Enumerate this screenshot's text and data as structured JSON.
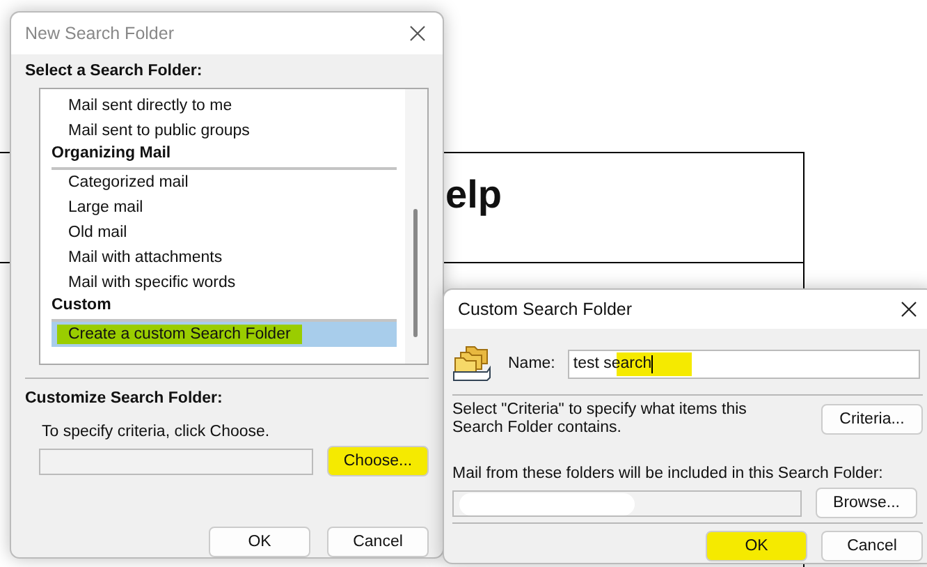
{
  "background_page": {
    "heading": "elp"
  },
  "new_search_folder": {
    "title": "New Search Folder",
    "select_label": "Select a Search Folder:",
    "items": [
      {
        "kind": "item",
        "label": "Mail sent directly to me",
        "selected": false,
        "highlight": false
      },
      {
        "kind": "item",
        "label": "Mail sent to public groups",
        "selected": false,
        "highlight": false
      },
      {
        "kind": "header",
        "label": "Organizing Mail"
      },
      {
        "kind": "item",
        "label": "Categorized mail",
        "selected": false,
        "highlight": false
      },
      {
        "kind": "item",
        "label": "Large mail",
        "selected": false,
        "highlight": false
      },
      {
        "kind": "item",
        "label": "Old mail",
        "selected": false,
        "highlight": false
      },
      {
        "kind": "item",
        "label": "Mail with attachments",
        "selected": false,
        "highlight": false
      },
      {
        "kind": "item",
        "label": "Mail with specific words",
        "selected": false,
        "highlight": false
      },
      {
        "kind": "header",
        "label": "Custom"
      },
      {
        "kind": "item",
        "label": "Create a custom Search Folder",
        "selected": true,
        "highlight": true
      }
    ],
    "customize_label": "Customize Search Folder:",
    "criteria_hint": "To specify criteria, click Choose.",
    "choose_button": {
      "label": "Choose...",
      "highlight": true
    },
    "buttons": [
      {
        "label": "OK",
        "highlight": false
      },
      {
        "label": "Cancel",
        "highlight": false
      }
    ]
  },
  "custom_search_folder": {
    "title": "Custom Search Folder",
    "name_label": "Name:",
    "name_value": "test search",
    "name_highlight": true,
    "criteria_text": "Select \"Criteria\" to specify what items this Search Folder contains.",
    "criteria_button": {
      "label": "Criteria...",
      "highlight": false
    },
    "folders_label": "Mail from these folders will be included in this Search Folder:",
    "browse_button": {
      "label": "Browse...",
      "highlight": false
    },
    "buttons": [
      {
        "label": "OK",
        "highlight": true
      },
      {
        "label": "Cancel",
        "highlight": false
      }
    ]
  }
}
